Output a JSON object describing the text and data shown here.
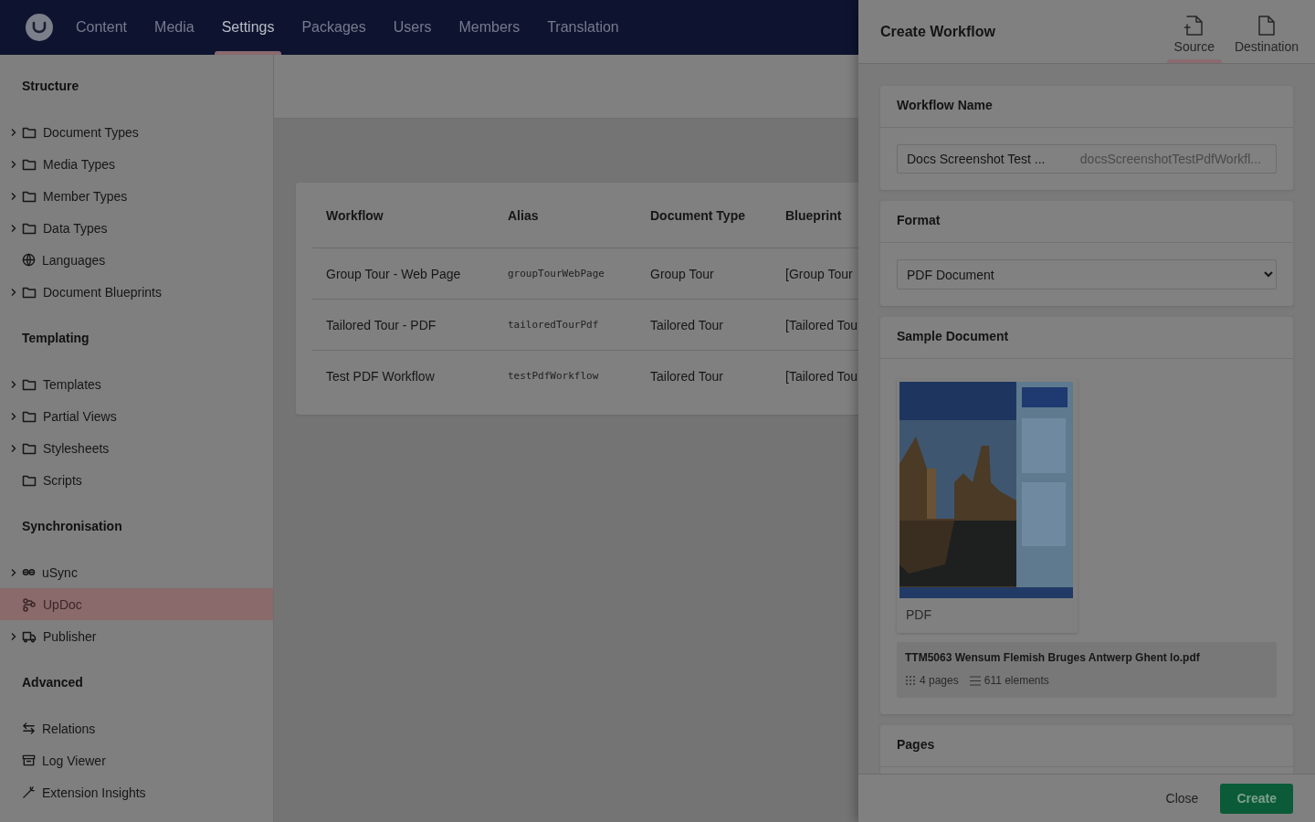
{
  "top_nav": {
    "items": [
      {
        "label": "Content",
        "selected": false
      },
      {
        "label": "Media",
        "selected": false
      },
      {
        "label": "Settings",
        "selected": true
      },
      {
        "label": "Packages",
        "selected": false
      },
      {
        "label": "Users",
        "selected": false
      },
      {
        "label": "Members",
        "selected": false
      },
      {
        "label": "Translation",
        "selected": false
      }
    ]
  },
  "sidebar": {
    "sections": [
      {
        "heading": "Structure",
        "items": [
          {
            "label": "Document Types",
            "kind": "folder",
            "expandable": true,
            "selected": false
          },
          {
            "label": "Media Types",
            "kind": "folder",
            "expandable": true,
            "selected": false
          },
          {
            "label": "Member Types",
            "kind": "folder",
            "expandable": true,
            "selected": false
          },
          {
            "label": "Data Types",
            "kind": "folder",
            "expandable": true,
            "selected": false
          },
          {
            "label": "Languages",
            "kind": "globe",
            "expandable": false,
            "selected": false
          },
          {
            "label": "Document Blueprints",
            "kind": "folder",
            "expandable": true,
            "selected": false
          }
        ]
      },
      {
        "heading": "Templating",
        "items": [
          {
            "label": "Templates",
            "kind": "folder",
            "expandable": true,
            "selected": false
          },
          {
            "label": "Partial Views",
            "kind": "folder",
            "expandable": true,
            "selected": false
          },
          {
            "label": "Stylesheets",
            "kind": "folder",
            "expandable": true,
            "selected": false
          },
          {
            "label": "Scripts",
            "kind": "folder",
            "expandable": false,
            "selected": false
          }
        ]
      },
      {
        "heading": "Synchronisation",
        "items": [
          {
            "label": "uSync",
            "kind": "link",
            "expandable": true,
            "selected": false
          },
          {
            "label": "UpDoc",
            "kind": "flow",
            "expandable": false,
            "selected": true
          },
          {
            "label": "Publisher",
            "kind": "truck",
            "expandable": true,
            "selected": false
          }
        ]
      },
      {
        "heading": "Advanced",
        "items": [
          {
            "label": "Relations",
            "kind": "arrows",
            "expandable": false,
            "selected": false
          },
          {
            "label": "Log Viewer",
            "kind": "archive",
            "expandable": false,
            "selected": false
          },
          {
            "label": "Extension Insights",
            "kind": "wand",
            "expandable": false,
            "selected": false
          }
        ]
      }
    ]
  },
  "table": {
    "columns": [
      "Workflow",
      "Alias",
      "Document Type",
      "Blueprint"
    ],
    "rows": [
      [
        "Group Tour - Web Page",
        "groupTourWebPage",
        "Group Tour",
        "[Group Tour"
      ],
      [
        "Tailored Tour - PDF",
        "tailoredTourPdf",
        "Tailored Tour",
        "[Tailored Tou"
      ],
      [
        "Test PDF Workflow",
        "testPdfWorkflow",
        "Tailored Tour",
        "[Tailored Tou"
      ]
    ]
  },
  "panel": {
    "title": "Create Workflow",
    "tabs": [
      {
        "label": "Source",
        "kind": "add",
        "selected": true
      },
      {
        "label": "Destination",
        "kind": "plain",
        "selected": false
      }
    ],
    "workflow_name": {
      "label": "Workflow Name",
      "name_value": "Docs Screenshot Test ...",
      "alias_value": "docsScreenshotTestPdfWorkfl..."
    },
    "format": {
      "label": "Format",
      "value": "PDF Document"
    },
    "sample_document": {
      "label": "Sample Document",
      "thumbnail": {
        "kind": "picture",
        "caption": "PDF"
      },
      "file_name": "TTM5063 Wensum Flemish Bruges Antwerp Ghent lo.pdf",
      "pages": "4 pages",
      "elements": "611 elements"
    },
    "pages_section": {
      "label": "Pages"
    },
    "buttons": [
      {
        "label": "Close",
        "kind": "link"
      },
      {
        "label": "Create",
        "kind": "primary"
      }
    ]
  }
}
